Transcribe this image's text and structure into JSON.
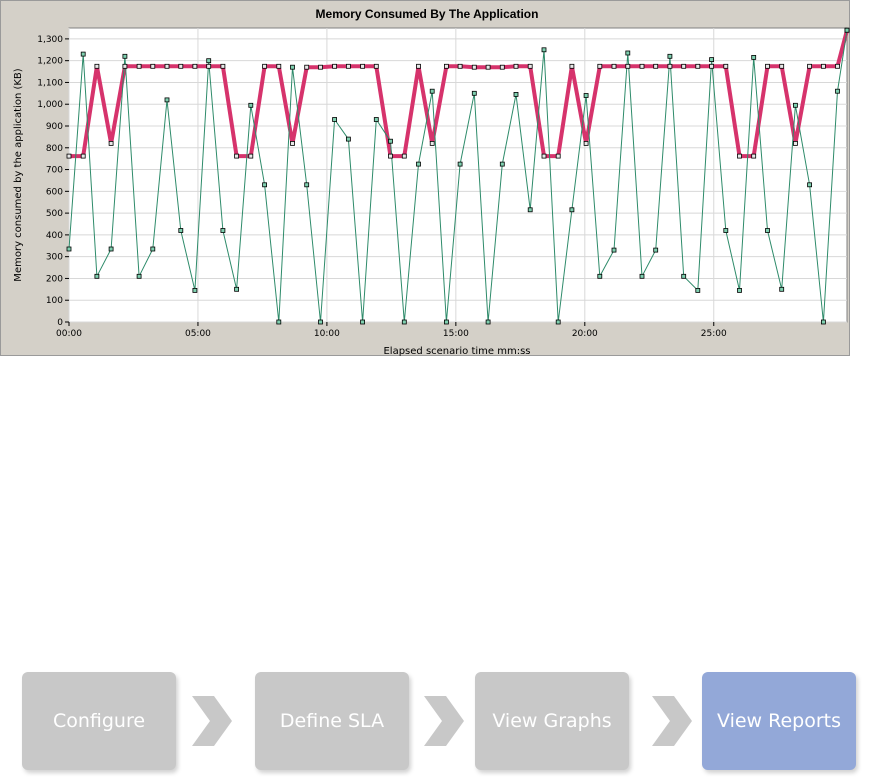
{
  "chart_data": {
    "type": "line",
    "title": "Memory Consumed By The Application",
    "xlabel": "Elapsed scenario time mm:ss",
    "ylabel": "Memory consumed by the application (KB)",
    "ylim": [
      0,
      1350
    ],
    "yticks": [
      0,
      100,
      200,
      300,
      400,
      500,
      600,
      700,
      800,
      900,
      1000,
      1100,
      1200,
      1300
    ],
    "ytick_labels": [
      "0",
      "100",
      "200",
      "300",
      "400",
      "500",
      "600",
      "700",
      "800",
      "900",
      "1,000",
      "1,100",
      "1,200",
      "1,300"
    ],
    "xlim": [
      0,
      1810
    ],
    "xticks": [
      0,
      300,
      600,
      900,
      1200,
      1500
    ],
    "xtick_labels": [
      "00:00",
      "05:00",
      "10:00",
      "15:00",
      "20:00",
      "25:00"
    ],
    "x_unit": "seconds",
    "grid": true,
    "series": [
      {
        "color": "#d6336c",
        "x": [
          0,
          33,
          65,
          98,
          130,
          163,
          195,
          228,
          260,
          293,
          325,
          358,
          390,
          423,
          455,
          488,
          520,
          553,
          585,
          618,
          650,
          683,
          715,
          748,
          780,
          813,
          845,
          878,
          910,
          943,
          975,
          1008,
          1040,
          1073,
          1105,
          1138,
          1170,
          1203,
          1235,
          1268,
          1300,
          1333,
          1365,
          1398,
          1430,
          1463,
          1495,
          1528,
          1560,
          1593,
          1625,
          1658,
          1690,
          1723,
          1755,
          1788,
          1810
        ],
        "values": [
          762,
          762,
          1174,
          820,
          1174,
          1174,
          1174,
          1174,
          1174,
          1174,
          1174,
          1174,
          762,
          762,
          1174,
          1174,
          820,
          1170,
          1170,
          1174,
          1174,
          1174,
          1174,
          762,
          762,
          1174,
          820,
          1174,
          1174,
          1170,
          1170,
          1170,
          1174,
          1174,
          762,
          762,
          1174,
          820,
          1174,
          1174,
          1174,
          1174,
          1174,
          1174,
          1174,
          1174,
          1174,
          1174,
          762,
          762,
          1174,
          1174,
          820,
          1174,
          1174,
          1174,
          1340
        ]
      },
      {
        "color": "#2e8b6a",
        "x": [
          0,
          33,
          65,
          98,
          130,
          163,
          195,
          228,
          260,
          293,
          325,
          358,
          390,
          423,
          455,
          488,
          520,
          553,
          585,
          618,
          650,
          683,
          715,
          748,
          780,
          813,
          845,
          878,
          910,
          943,
          975,
          1008,
          1040,
          1073,
          1105,
          1138,
          1170,
          1203,
          1235,
          1268,
          1300,
          1333,
          1365,
          1398,
          1430,
          1463,
          1495,
          1528,
          1560,
          1593,
          1625,
          1658,
          1690,
          1723,
          1755,
          1788,
          1810
        ],
        "values": [
          335,
          1230,
          210,
          335,
          1220,
          210,
          335,
          1020,
          420,
          145,
          1200,
          420,
          150,
          995,
          630,
          0,
          1170,
          630,
          0,
          930,
          840,
          0,
          930,
          830,
          0,
          725,
          1060,
          0,
          725,
          1050,
          0,
          725,
          1045,
          515,
          1250,
          0,
          515,
          1040,
          210,
          330,
          1235,
          210,
          330,
          1220,
          210,
          145,
          1205,
          420,
          145,
          1215,
          420,
          150,
          995,
          630,
          0,
          1060,
          1340
        ]
      }
    ]
  },
  "workflow": {
    "steps": [
      {
        "label": "Configure",
        "active": false
      },
      {
        "label": "Define SLA",
        "active": false
      },
      {
        "label": "View Graphs",
        "active": false
      },
      {
        "label": "View Reports",
        "active": true
      }
    ],
    "colors": {
      "inactive": "#c8c8c8",
      "active": "#93a8d8",
      "arrow": "#c8c8c8"
    }
  }
}
